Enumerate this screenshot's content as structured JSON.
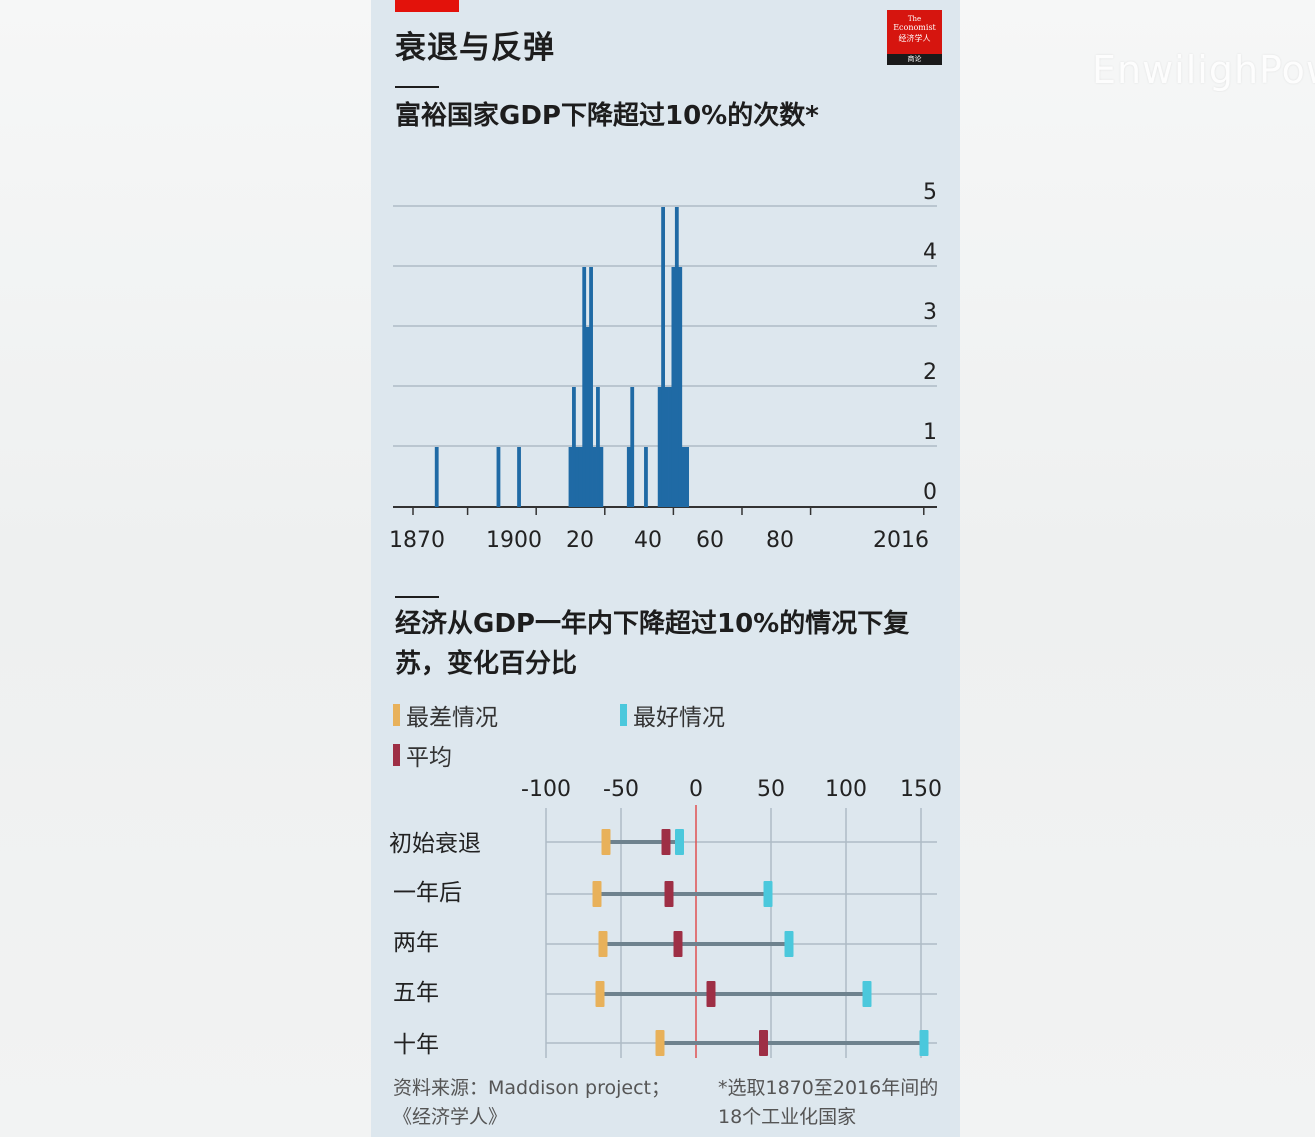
{
  "title": "衰退与反弹",
  "logo": {
    "line1": "The",
    "line2": "Economist",
    "line3": "经济学人",
    "line4": "商论"
  },
  "watermark": "EnwilighPow",
  "colors": {
    "bar": "#1f6aa5",
    "worst": "#e8b15a",
    "best": "#4bc8dc",
    "avg": "#9e2f45",
    "zero_line": "#e05050",
    "range": "#6e828e"
  },
  "chart_data": [
    {
      "type": "bar",
      "title": "富裕国家GDP下降超过10%的次数*",
      "x_ticks": [
        "1870",
        "1900",
        "20",
        "40",
        "60",
        "80",
        "2016"
      ],
      "y_ticks": [
        "0",
        "1",
        "2",
        "3",
        "4",
        "5"
      ],
      "xlim": [
        1870,
        2016
      ],
      "ylim": [
        0,
        5
      ],
      "x": [
        1874,
        1892,
        1898,
        1913,
        1914,
        1915,
        1916,
        1917,
        1918,
        1919,
        1920,
        1921,
        1922,
        1930,
        1931,
        1935,
        1939,
        1940,
        1941,
        1942,
        1943,
        1944,
        1945,
        1946,
        1947
      ],
      "values": [
        1,
        1,
        1,
        1,
        2,
        1,
        1,
        4,
        3,
        4,
        1,
        2,
        1,
        1,
        2,
        1,
        2,
        5,
        2,
        2,
        4,
        5,
        4,
        1,
        1
      ]
    },
    {
      "type": "range",
      "title": "经济从GDP一年内下降超过10%的情况下复苏，变化百分比",
      "legend": {
        "worst": "最差情况",
        "best": "最好情况",
        "avg": "平均"
      },
      "x_ticks": [
        "-100",
        "-50",
        "0",
        "50",
        "100",
        "150"
      ],
      "xlim": [
        -100,
        150
      ],
      "categories": [
        "初始衰退",
        "一年后",
        "两年",
        "五年",
        "十年"
      ],
      "worst": [
        -60,
        -66,
        -62,
        -64,
        -24
      ],
      "avg": [
        -20,
        -18,
        -12,
        10,
        45
      ],
      "best": [
        -11,
        48,
        62,
        114,
        152
      ]
    }
  ],
  "source": {
    "left_line1": "资料来源：Maddison project；",
    "left_line2": "《经济学人》",
    "right_line1": "*选取1870至2016年间的",
    "right_line2": "18个工业化国家"
  }
}
